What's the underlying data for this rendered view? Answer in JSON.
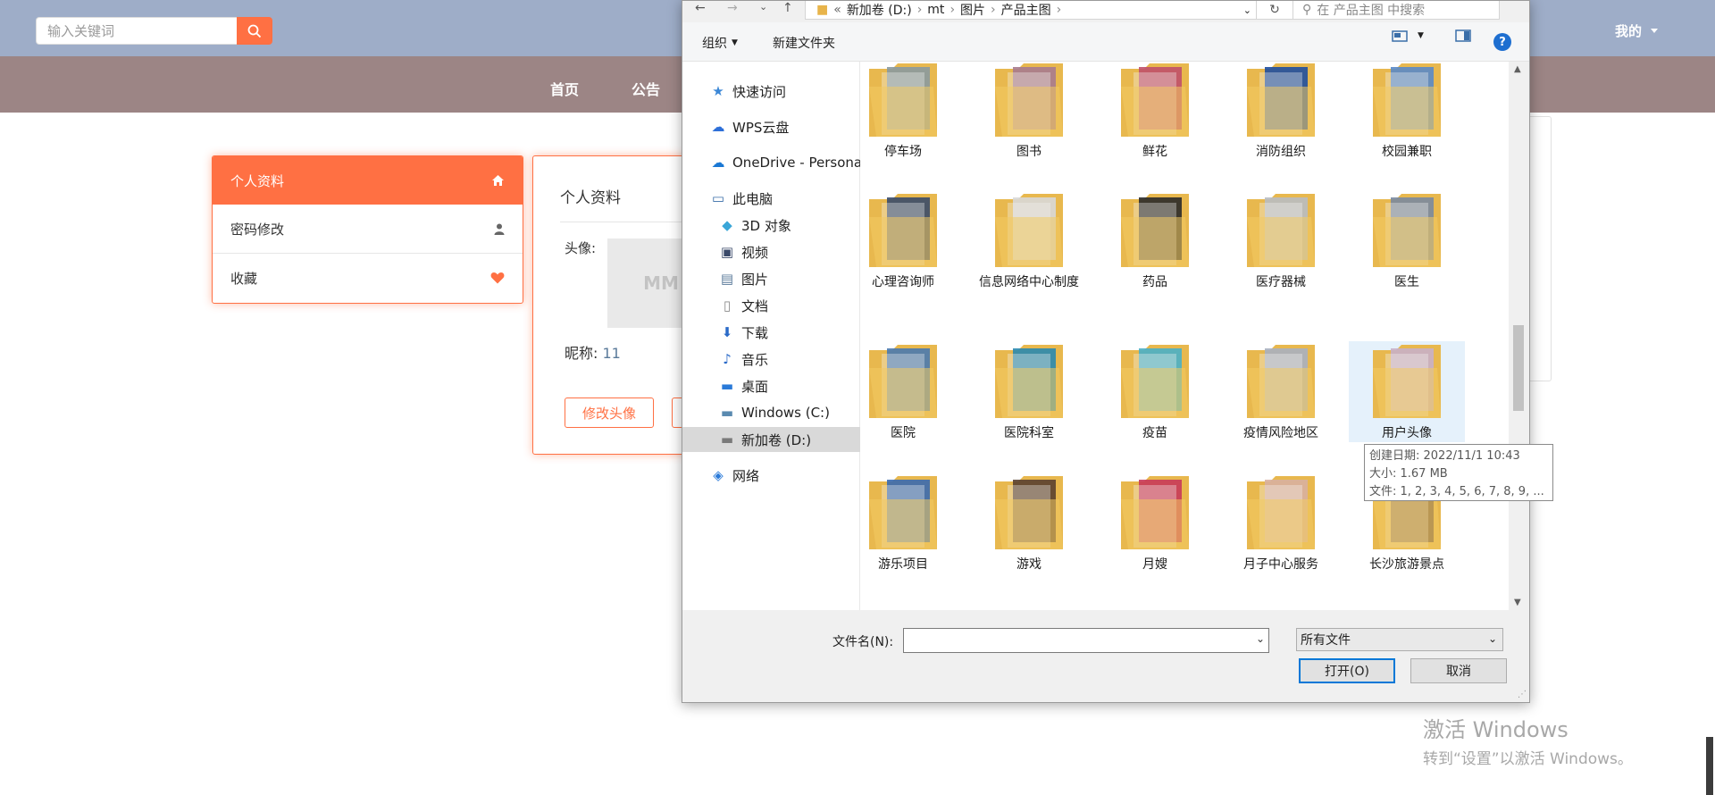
{
  "header": {
    "search_placeholder": "输入关键词",
    "user_label": "我的"
  },
  "nav": {
    "items": [
      "首页",
      "公告"
    ]
  },
  "side_menu": {
    "items": [
      {
        "label": "个人资料"
      },
      {
        "label": "密码修改"
      },
      {
        "label": "收藏"
      }
    ]
  },
  "profile": {
    "title": "个人资料",
    "avatar_label": "头像:",
    "avatar_placeholder": "MM",
    "nick_label": "昵称:",
    "nick_value": "11",
    "change_avatar_button": "修改头像"
  },
  "dialog": {
    "breadcrumb": [
      "新加卷 (D:)",
      "mt",
      "图片",
      "产品主图"
    ],
    "search_placeholder": "在 产品主图 中搜索",
    "toolbar": {
      "organize": "组织",
      "new_folder": "新建文件夹"
    },
    "nav_items": [
      {
        "label": "快速访问",
        "icon": "star-icon"
      },
      {
        "label": "WPS云盘",
        "icon": "cloud-icon"
      },
      {
        "label": "OneDrive - Persona",
        "icon": "onedrive-icon"
      },
      {
        "label": "此电脑",
        "icon": "computer-icon"
      },
      {
        "label": "3D 对象",
        "icon": "cube-icon"
      },
      {
        "label": "视频",
        "icon": "video-icon"
      },
      {
        "label": "图片",
        "icon": "picture-icon"
      },
      {
        "label": "文档",
        "icon": "document-icon"
      },
      {
        "label": "下载",
        "icon": "download-icon"
      },
      {
        "label": "音乐",
        "icon": "music-icon"
      },
      {
        "label": "桌面",
        "icon": "desktop-icon"
      },
      {
        "label": "Windows (C:)",
        "icon": "drive-c-icon"
      },
      {
        "label": "新加卷 (D:)",
        "icon": "drive-d-icon"
      },
      {
        "label": "网络",
        "icon": "network-icon"
      }
    ],
    "folders": [
      {
        "label": "停车场",
        "thumb": "#8a9aa0"
      },
      {
        "label": "图书",
        "thumb": "#a77b8f"
      },
      {
        "label": "鲜花",
        "thumb": "#c0506a"
      },
      {
        "label": "消防组织",
        "thumb": "#1f4fa0"
      },
      {
        "label": "校园兼职",
        "thumb": "#5a8ac8"
      },
      {
        "label": "心理咨询师",
        "thumb": "#3a4b6a"
      },
      {
        "label": "信息网络中心制度",
        "thumb": "#d8d8d8"
      },
      {
        "label": "药品",
        "thumb": "#2a2a2a"
      },
      {
        "label": "医疗器械",
        "thumb": "#b8bcc2"
      },
      {
        "label": "医生",
        "thumb": "#7a8aa0"
      },
      {
        "label": "医院",
        "thumb": "#4a7ab0"
      },
      {
        "label": "医院科室",
        "thumb": "#2a8ab0"
      },
      {
        "label": "疫苗",
        "thumb": "#4ab0c8"
      },
      {
        "label": "疫情风险地区",
        "thumb": "#a8b0c0"
      },
      {
        "label": "用户头像",
        "thumb": "#c8b0c8"
      },
      {
        "label": "游乐项目",
        "thumb": "#3a6ab0"
      },
      {
        "label": "游戏",
        "thumb": "#5a4030"
      },
      {
        "label": "月嫂",
        "thumb": "#c83a5a"
      },
      {
        "label": "月子中心服务",
        "thumb": "#d8b0a0"
      },
      {
        "label": "长沙旅游景点",
        "thumb": "#6a5040"
      }
    ],
    "tooltip": {
      "created": "创建日期: 2022/11/1 10:43",
      "size": "大小: 1.67 MB",
      "files": "文件: 1, 2, 3, 4, 5, 6, 7, 8, 9, ..."
    },
    "filename_label": "文件名(N):",
    "filename_value": "",
    "filetype": "所有文件",
    "open_button": "打开(O)",
    "cancel_button": "取消"
  },
  "watermark": {
    "line1": "激活 Windows",
    "line2": "转到“设置”以激活 Windows。"
  },
  "colors": {
    "accent": "#ff7043",
    "topbar": "#9eadc8",
    "navbar": "#9c8585"
  }
}
